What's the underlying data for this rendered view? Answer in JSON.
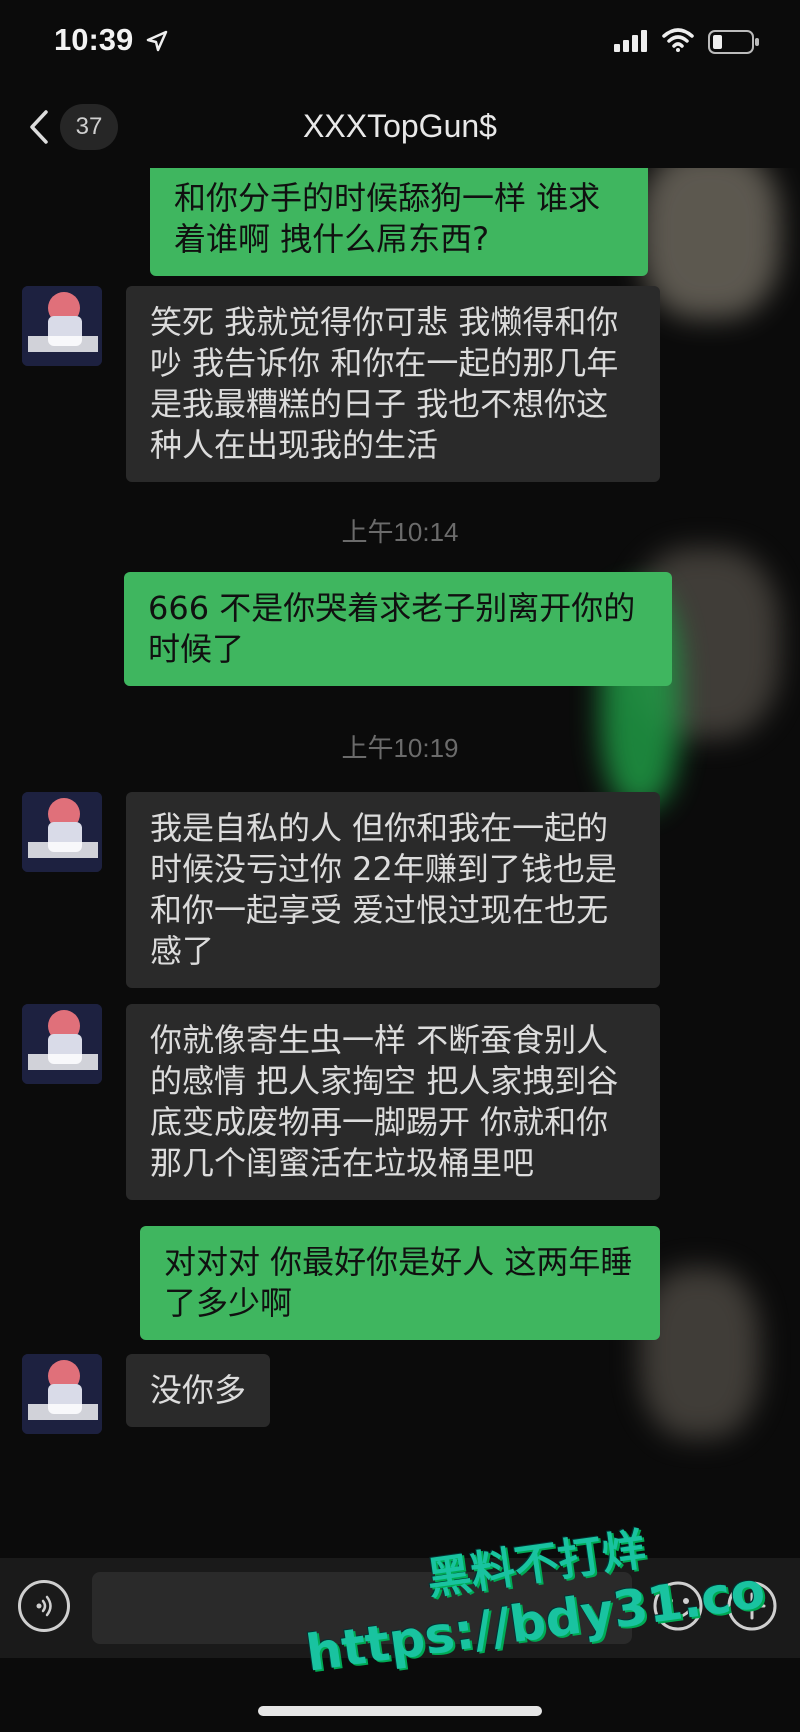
{
  "status_bar": {
    "time": "10:39"
  },
  "nav": {
    "back_count": "37",
    "title": "XXXTopGun$"
  },
  "messages": [
    {
      "side": "sent",
      "text": "和你分手的时候舔狗一样 谁求着谁啊 拽什么屌东西?"
    },
    {
      "side": "recv",
      "text": "笑死 我就觉得你可悲 我懒得和你吵 我告诉你 和你在一起的那几年 是我最糟糕的日子 我也不想你这种人在出现我的生活"
    },
    {
      "timestamp": "上午10:14"
    },
    {
      "side": "sent",
      "text": "666 不是你哭着求老子别离开你的时候了"
    },
    {
      "timestamp": "上午10:19"
    },
    {
      "side": "recv",
      "text": "我是自私的人 但你和我在一起的时候没亏过你 22年赚到了钱也是和你一起享受 爱过恨过现在也无感了"
    },
    {
      "side": "recv",
      "text": "你就像寄生虫一样 不断蚕食别人的感情 把人家掏空 把人家拽到谷底变成废物再一脚踢开 你就和你那几个闺蜜活在垃圾桶里吧"
    },
    {
      "side": "sent",
      "text": "对对对 你最好你是好人 这两年睡了多少啊"
    },
    {
      "side": "recv",
      "text": "没你多"
    }
  ],
  "watermark": {
    "line1": "黑料不打烊",
    "line2": "https://bdy31.co"
  },
  "colors": {
    "sent_bubble": "#3fb65f",
    "recv_bubble": "#2a2a2a",
    "background": "#0b0b0b"
  },
  "icons": [
    "location-arrow-icon",
    "signal-icon",
    "wifi-icon",
    "battery-icon",
    "back-chevron-icon",
    "voice-icon",
    "emoji-icon",
    "plus-icon"
  ]
}
